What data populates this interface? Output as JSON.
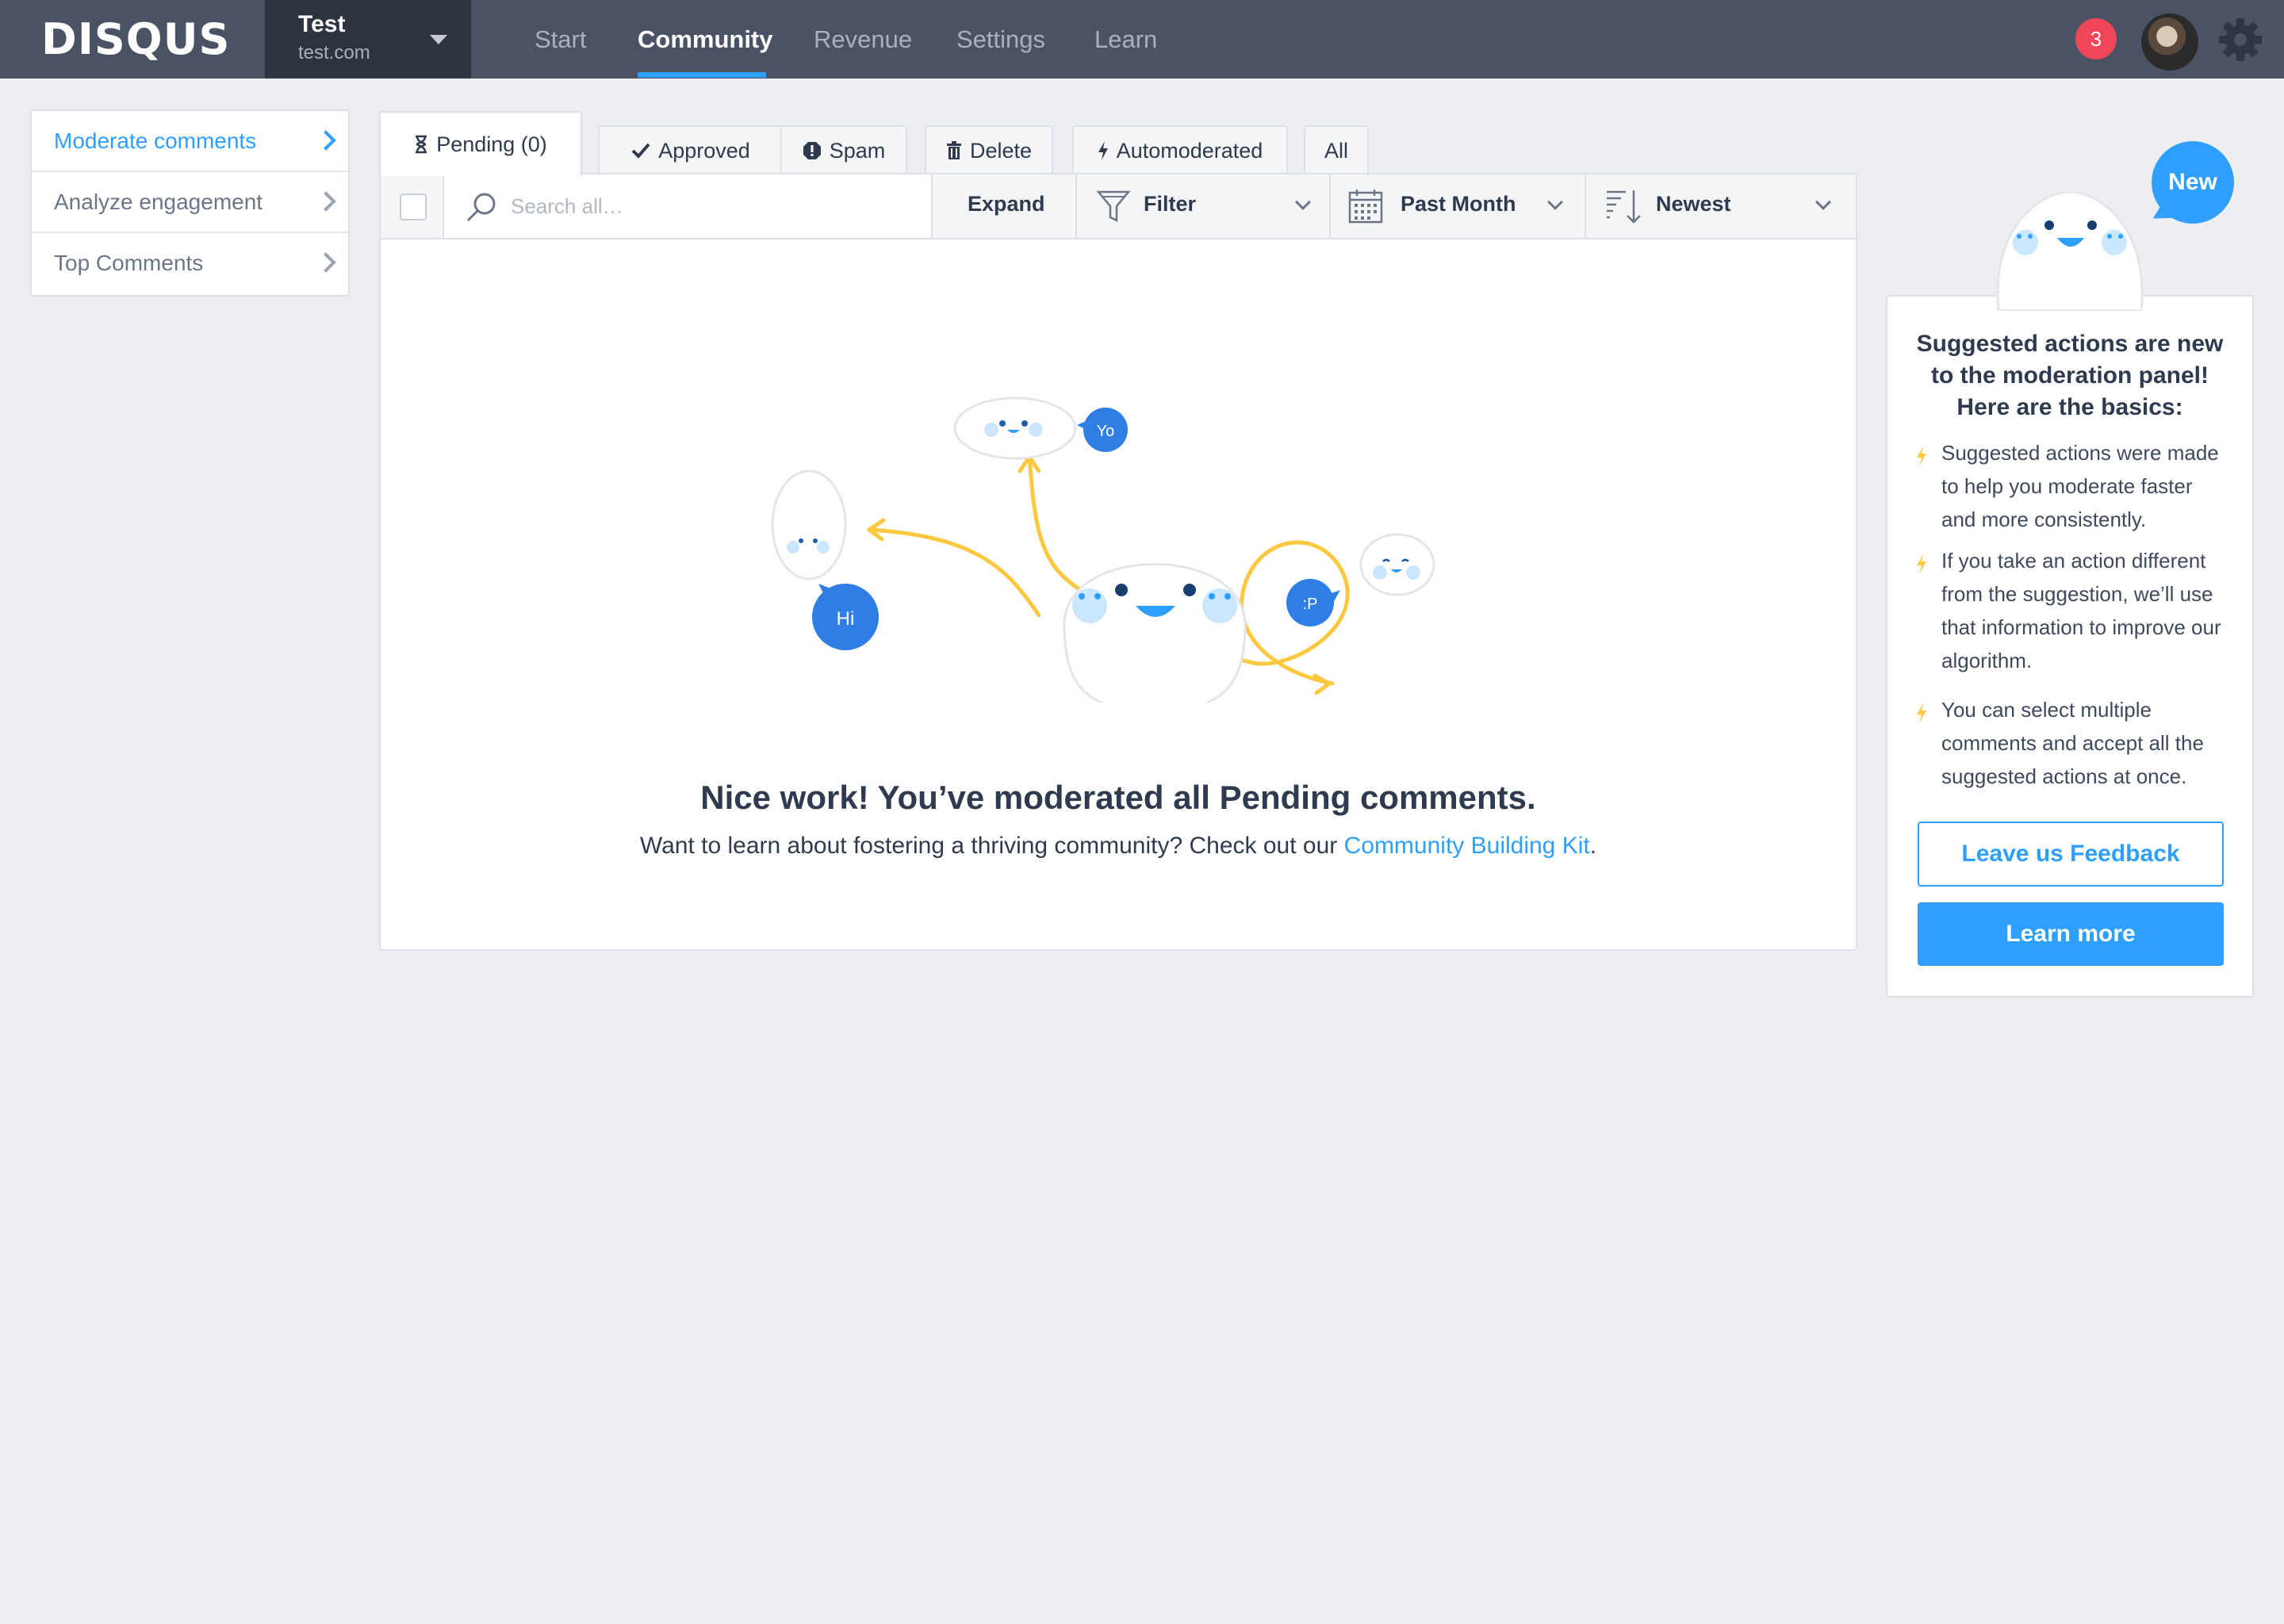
{
  "brand": {
    "logo": "DISQUS"
  },
  "site": {
    "name": "Test",
    "url": "test.com"
  },
  "nav": {
    "items": [
      "Start",
      "Community",
      "Revenue",
      "Settings",
      "Learn"
    ],
    "active": "Community"
  },
  "header": {
    "notification_count": "3"
  },
  "sidebar": {
    "items": [
      {
        "label": "Moderate comments",
        "active": true
      },
      {
        "label": "Analyze engagement",
        "active": false
      },
      {
        "label": "Top Comments",
        "active": false
      }
    ]
  },
  "tabs": [
    {
      "label": "Pending (0)",
      "icon": "hourglass-icon",
      "active": true
    },
    {
      "label": "Approved",
      "icon": "check-icon",
      "active": false
    },
    {
      "label": "Spam",
      "icon": "alert-icon",
      "active": false
    },
    {
      "label": "Delete",
      "icon": "trash-icon",
      "active": false
    },
    {
      "label": "Automoderated",
      "icon": "bolt-icon",
      "active": false
    },
    {
      "label": "All",
      "icon": "",
      "active": false
    }
  ],
  "toolbar": {
    "search_placeholder": "Search all…",
    "expand_label": "Expand",
    "filter_label": "Filter",
    "date_label": "Past Month",
    "sort_label": "Newest"
  },
  "empty_state": {
    "bubbles": [
      "Yo",
      "Hi",
      ":P"
    ],
    "title": "Nice work! You’ve moderated all Pending comments.",
    "subtitle": "Want to learn about fostering a thriving community? Check out our ",
    "link_text": "Community Building Kit",
    "suffix": "."
  },
  "tip": {
    "badge": "New",
    "title": "Suggested actions are new to the moderation panel! Here are the basics:",
    "items": [
      "Suggested actions were made to help you moderate faster and more consistently.",
      "If you take an action different from the suggestion, we’ll use that information to improve our algorithm.",
      "You can select multiple comments and accept all the suggested actions at once."
    ],
    "feedback_button": "Leave us Feedback",
    "learn_button": "Learn more"
  },
  "colors": {
    "topbar": "#4a5263",
    "accent": "#2e9fff",
    "badge": "#f0465a",
    "illustration_yellow": "#fcc83f"
  }
}
